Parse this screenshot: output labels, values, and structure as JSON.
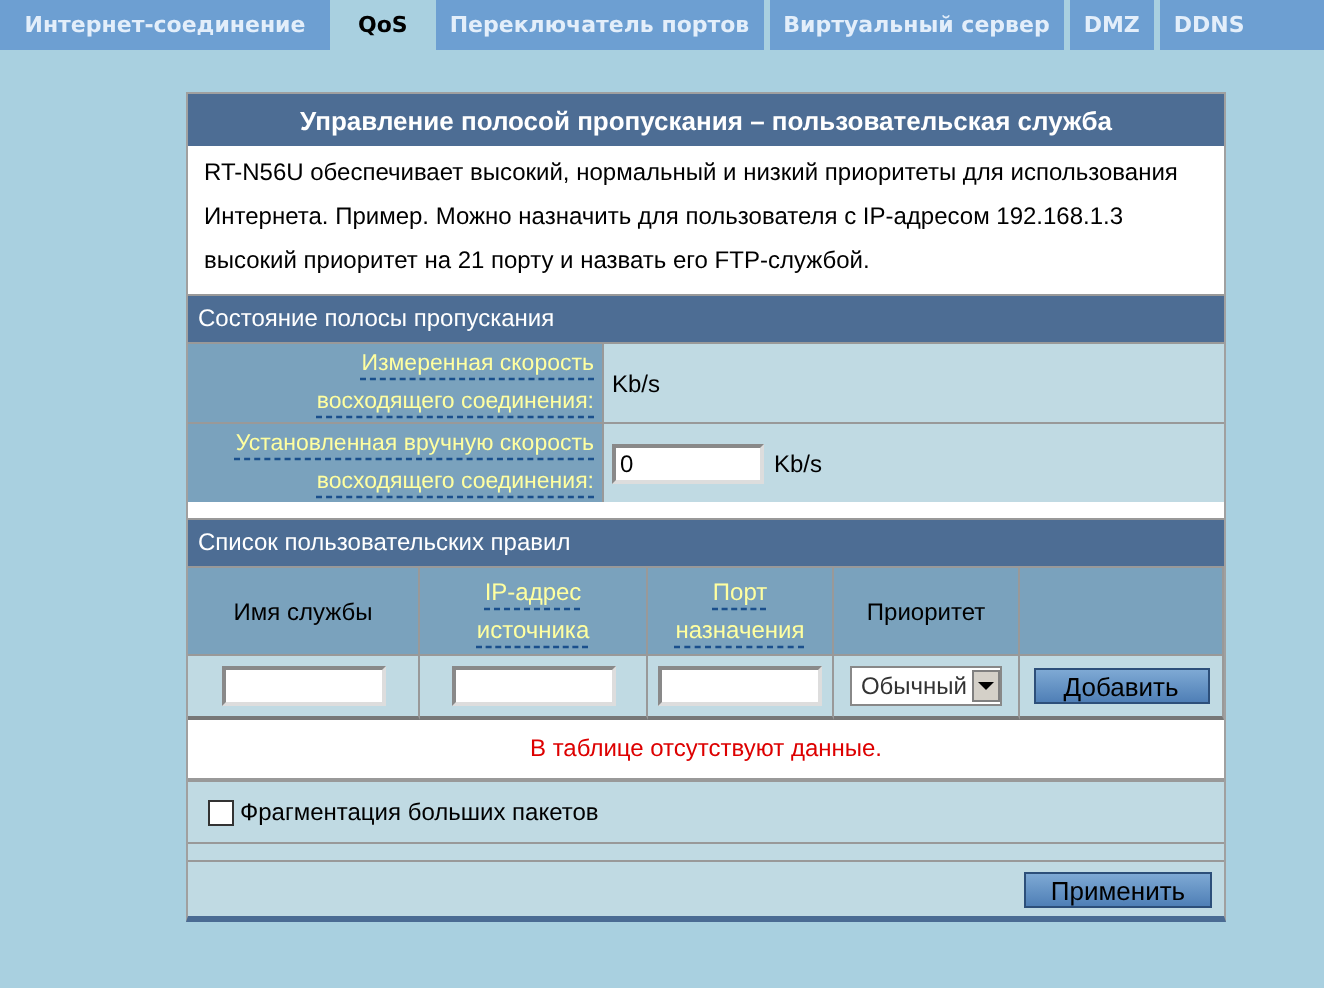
{
  "tabs": [
    {
      "label": "Интернет-соединение",
      "selected": false
    },
    {
      "label": "QoS",
      "selected": true
    },
    {
      "label": "Переключатель портов",
      "selected": false
    },
    {
      "label": "Виртуальный сервер",
      "selected": false
    },
    {
      "label": "DMZ",
      "selected": false
    },
    {
      "label": "DDNS",
      "selected": false
    }
  ],
  "panel": {
    "title": "Управление полосой пропускания – пользовательская служба",
    "description": "RT-N56U обеспечивает высокий, нормальный и низкий приоритеты для использования Интернета. Пример. Можно назначить для пользователя с IP-адресом 192.168.1.3 высокий приоритет на 21 порту и назвать его FTP-службой."
  },
  "bandwidth": {
    "title": "Состояние полосы пропускания",
    "rows": [
      {
        "kind": "text",
        "label": "Измеренная скорость\nвосходящего соединения:",
        "unit": "Kb/s"
      },
      {
        "kind": "input",
        "label": "Установленная вручную скорость\nвосходящего соединения:",
        "value": "0",
        "unit": "Kb/s"
      }
    ]
  },
  "rules": {
    "title": "Список пользовательских правил",
    "columns": [
      {
        "label": "Имя службы",
        "hint": false
      },
      {
        "label": "IP-адрес источника",
        "hint": true
      },
      {
        "label": "Порт назначения",
        "hint": true
      },
      {
        "label": "Приоритет",
        "hint": false
      }
    ],
    "priority": "Обычный",
    "add_button": "Добавить",
    "empty_message": "В таблице отсутствуют данные."
  },
  "fragmentation": {
    "label": "Фрагментация больших пакетов",
    "checked": false
  },
  "apply_button": "Применить"
}
